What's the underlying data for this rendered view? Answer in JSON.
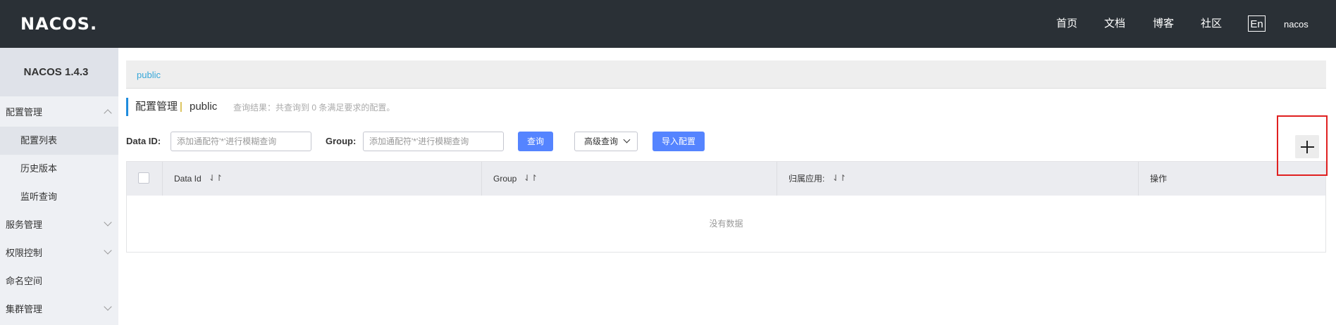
{
  "brand": {
    "logo": "NACOS.",
    "version": "NACOS 1.4.3"
  },
  "topnav": {
    "items": [
      "首页",
      "文档",
      "博客",
      "社区"
    ],
    "lang": "En",
    "user": "nacos"
  },
  "sidebar": {
    "items": [
      {
        "label": "配置管理",
        "expanded": true
      },
      {
        "label": "配置列表",
        "sub": true,
        "active": true
      },
      {
        "label": "历史版本",
        "sub": true
      },
      {
        "label": "监听查询",
        "sub": true
      },
      {
        "label": "服务管理",
        "expanded": false
      },
      {
        "label": "权限控制",
        "expanded": false
      },
      {
        "label": "命名空间"
      },
      {
        "label": "集群管理",
        "expanded": false
      }
    ]
  },
  "namespace": {
    "current": "public"
  },
  "title": {
    "main": "配置管理",
    "sep": "|",
    "ns": "public",
    "hint": "查询结果：共查询到 0 条满足要求的配置。"
  },
  "search": {
    "dataid_label": "Data ID:",
    "dataid_placeholder": "添加通配符'*'进行模糊查询",
    "group_label": "Group:",
    "group_placeholder": "添加通配符'*'进行模糊查询",
    "query": "查询",
    "advanced": "高级查询",
    "import": "导入配置"
  },
  "table": {
    "columns": [
      "Data Id",
      "Group",
      "归属应用:",
      "操作"
    ],
    "sort_icon": "⇃↾",
    "empty": "没有数据"
  },
  "add_button": {
    "icon": "plus-icon"
  },
  "colors": {
    "topbar": "#2a3036",
    "accent": "#5584ff",
    "link": "#36a7d8",
    "highlight": "#e02020"
  }
}
